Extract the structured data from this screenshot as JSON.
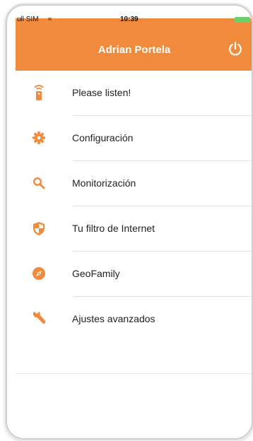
{
  "status_bar": {
    "carrier": "ull SIM",
    "wifi": "≈",
    "time": "10:39"
  },
  "header": {
    "title": "Adrian Portela",
    "power_icon": "power-icon"
  },
  "menu": {
    "items": [
      {
        "label": "Please listen!",
        "icon": "remote-icon"
      },
      {
        "label": "Configuración",
        "icon": "gear-icon"
      },
      {
        "label": "Monitorización",
        "icon": "search-icon"
      },
      {
        "label": "Tu filtro de Internet",
        "icon": "shield-icon"
      },
      {
        "label": "GeoFamily",
        "icon": "compass-icon"
      },
      {
        "label": "Ajustes avanzados",
        "icon": "wrench-icon"
      }
    ]
  },
  "colors": {
    "accent": "#f08a3c",
    "text": "#222222",
    "separator": "#e6e6e6"
  }
}
